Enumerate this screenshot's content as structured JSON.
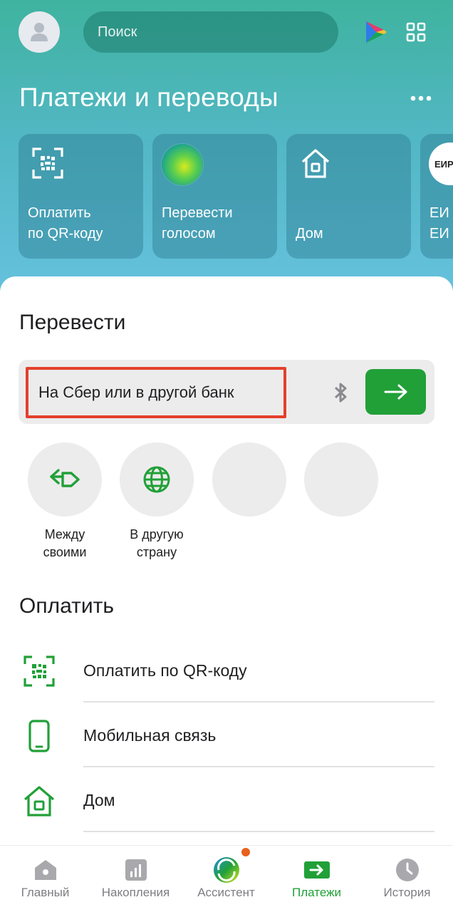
{
  "header": {
    "search_placeholder": "Поиск",
    "page_title": "Платежи и переводы"
  },
  "quick_actions": [
    {
      "label": "Оплатить\nпо QR-коду",
      "icon": "qr-icon"
    },
    {
      "label": "Перевести\nголосом",
      "icon": "voice-assistant-icon"
    },
    {
      "label": "Дом",
      "icon": "house-icon"
    },
    {
      "label": "ЕИ\nЕИ",
      "icon": "eirc-logo",
      "logo_text": "ЕИРЦ"
    }
  ],
  "transfer": {
    "section_title": "Перевести",
    "input_text": "На Сбер или в другой банк",
    "shortcuts": [
      {
        "label": "Между\nсвоими",
        "icon": "between-accounts-icon"
      },
      {
        "label": "В другую\nстрану",
        "icon": "globe-icon"
      },
      {
        "label": "",
        "icon": "placeholder"
      },
      {
        "label": "",
        "icon": "placeholder"
      }
    ]
  },
  "pay": {
    "section_title": "Оплатить",
    "items": [
      {
        "label": "Оплатить по QR-коду",
        "icon": "qr-icon"
      },
      {
        "label": "Мобильная связь",
        "icon": "phone-icon"
      },
      {
        "label": "Дом",
        "icon": "house-icon"
      }
    ]
  },
  "bottom_nav": [
    {
      "label": "Главный",
      "icon": "home-icon",
      "active": false
    },
    {
      "label": "Накопления",
      "icon": "chart-icon",
      "active": false
    },
    {
      "label": "Ассистент",
      "icon": "assistant-icon",
      "active": false
    },
    {
      "label": "Платежи",
      "icon": "payments-icon",
      "active": true
    },
    {
      "label": "История",
      "icon": "clock-icon",
      "active": false
    }
  ],
  "colors": {
    "brand_green": "#21a038",
    "highlight_red": "#e4402c",
    "header_top": "#3fb39f",
    "header_bottom": "#67c2df",
    "badge_orange": "#e8601c"
  }
}
